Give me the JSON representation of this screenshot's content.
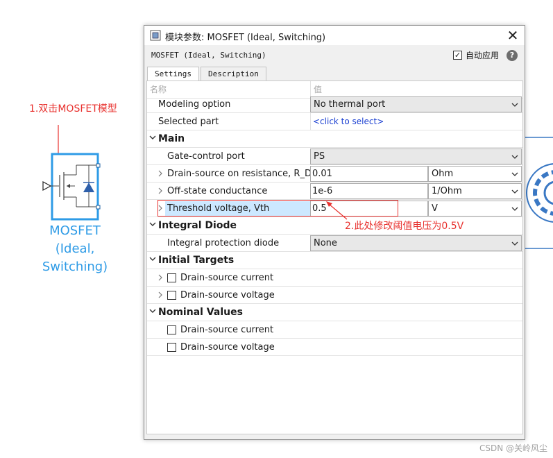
{
  "annotations": {
    "step1": "1.双击MOSFET模型",
    "step2": "2.此处修改阈值电压为0.5V"
  },
  "block_label": [
    "MOSFET",
    "(Ideal,",
    "Switching)"
  ],
  "dialog": {
    "title": "模块参数: MOSFET (Ideal, Switching)",
    "block_name": "MOSFET (Ideal, Switching)",
    "auto_apply_label": "自动应用",
    "auto_apply_checked": true,
    "tabs": [
      "Settings",
      "Description"
    ],
    "grid_header": {
      "name": "名称",
      "value": "值"
    },
    "rows": {
      "modeling_option": {
        "name": "Modeling option",
        "value": "No thermal port"
      },
      "selected_part": {
        "name": "Selected part",
        "value": "<click to select>"
      },
      "main": "Main",
      "gate_control": {
        "name": "Gate-control port",
        "value": "PS"
      },
      "rds": {
        "name": "Drain-source on resistance, R_DS...",
        "value": "0.01",
        "unit": "Ohm"
      },
      "off_cond": {
        "name": "Off-state conductance",
        "value": "1e-6",
        "unit": "1/Ohm"
      },
      "vth": {
        "name": "Threshold voltage, Vth",
        "value": "0.5",
        "unit": "V"
      },
      "integral_diode": "Integral Diode",
      "protection_diode": {
        "name": "Integral protection diode",
        "value": "None"
      },
      "initial_targets": "Initial Targets",
      "it_current": "Drain-source current",
      "it_voltage": "Drain-source voltage",
      "nominal_values": "Nominal Values",
      "nv_current": "Drain-source current",
      "nv_voltage": "Drain-source voltage"
    }
  },
  "watermark": "CSDN @关岭风尘",
  "colors": {
    "annotation_red": "#e8312e",
    "block_blue": "#2e9be6",
    "link_blue": "#1a3fd1",
    "highlight": "#cce8ff"
  }
}
